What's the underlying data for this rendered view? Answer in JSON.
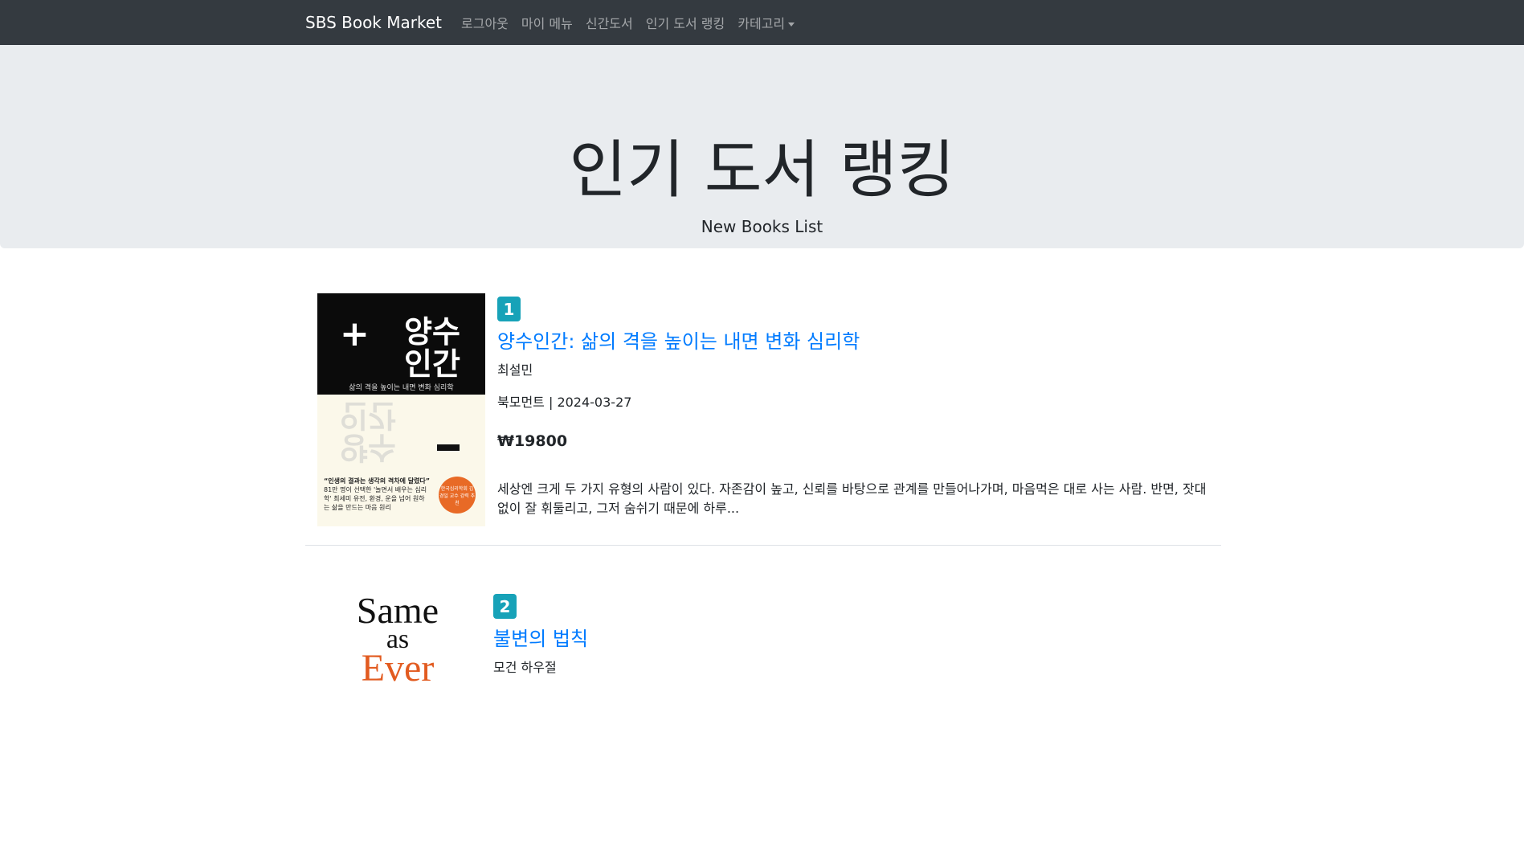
{
  "navbar": {
    "brand": "SBS Book Market",
    "links": [
      "로그아웃",
      "마이 메뉴",
      "신간도서",
      "인기 도서 랭킹",
      "카테고리"
    ]
  },
  "jumbotron": {
    "title": "인기 도서 랭킹",
    "subtitle": "New Books List"
  },
  "books": [
    {
      "rank": "1",
      "title": "양수인간: 삶의 격을 높이는 내면 변화 심리학",
      "author": "최설민",
      "publisher_date": "북모먼트 | 2024-03-27",
      "price": "₩19800",
      "description": "세상엔 크게 두 가지 유형의 사람이 있다. 자존감이 높고, 신뢰를 바탕으로 관계를 만들어나가며, 마음먹은 대로 사는 사람. 반면, 잣대 없이 잘 휘둘리고, 그저 숨쉬기 때문에 하루...",
      "cover": {
        "plus": "+",
        "title_line1": "양수",
        "title_line2": "인간",
        "subtitle": "삶의 격을 높이는 내면 변화 심리학",
        "quote": "“인생의 결과는 생각의 격차에 달렸다”",
        "quote_sub": "81만 명이 선택한 '놀면서 배우는 심리학' 최세미 유전, 환경, 운을 넘어 원하는 삶을 만드는 마음 원리",
        "seal": "한국심리학회 김경일 교수 강력 추천"
      }
    },
    {
      "rank": "2",
      "title": "불변의 법칙",
      "author": "모건 하우절",
      "cover": {
        "line1": "Same",
        "line2": "as",
        "line3": "Ever"
      }
    }
  ]
}
